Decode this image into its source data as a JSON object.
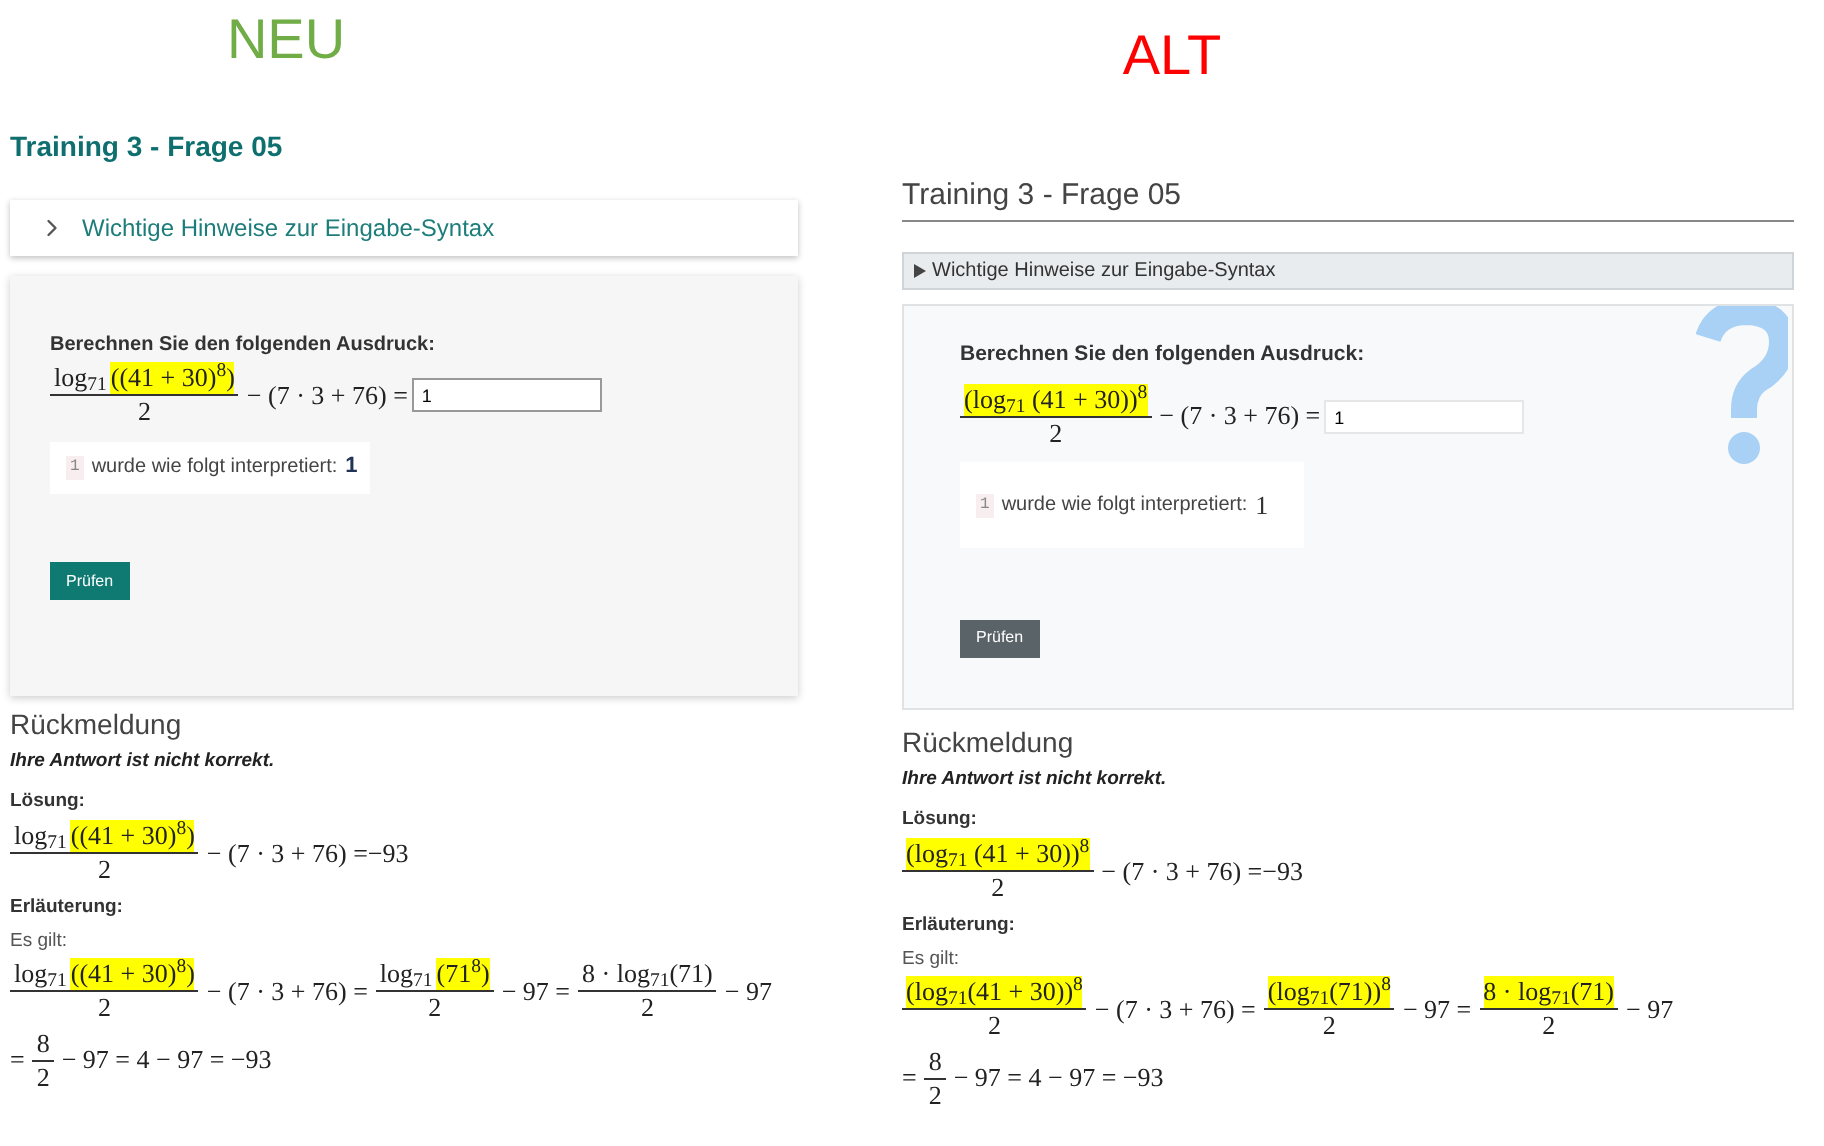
{
  "panels": [
    {
      "kind": "new",
      "label": "NEU",
      "color": "#70ad47",
      "title": "Training 3 - Frage 05",
      "hint": "Wichtige Hinweise zur Eingabe-Syntax",
      "prompt": "Berechnen Sie den folgenden Ausdruck:",
      "equation": [
        {
          "kind": "frac",
          "num": [
            {
              "text": "log$_{71}$",
              "highlighted": false
            },
            {
              "text": "((41 + 30)$^{8}$)",
              "highlighted": true
            }
          ],
          "den": [
            {
              "text": "2",
              "highlighted": false
            }
          ]
        },
        {
          "kind": "text",
          "parts": [
            {
              "text": "− (7 · 3 + 76) =",
              "highlighted": false
            }
          ]
        }
      ],
      "answer": {
        "value": "1"
      },
      "interpretation": {
        "code": "1",
        "text": "wurde wie folgt interpretiert:",
        "value": "1"
      },
      "check_button": "Prüfen",
      "feedback": {
        "heading": "Rückmeldung",
        "verdict": "Ihre Antwort ist nicht korrekt.",
        "solution_label": "Lösung:",
        "solution": [
          {
            "kind": "frac",
            "num": [
              {
                "text": "log$_{71}$",
                "highlighted": false
              },
              {
                "text": "((41 + 30)$^{8}$)",
                "highlighted": true
              }
            ],
            "den": [
              {
                "text": "2",
                "highlighted": false
              }
            ]
          },
          {
            "kind": "text",
            "parts": [
              {
                "text": "− (7 · 3 + 76) =−93",
                "highlighted": false
              }
            ]
          }
        ],
        "explanation_label": "Erläuterung:",
        "explanation_intro": "Es gilt:",
        "explanation_lines": [
          [
            {
              "kind": "frac",
              "num": [
                {
                  "text": "log$_{71}$",
                  "highlighted": false
                },
                {
                  "text": "((41 + 30)$^{8}$)",
                  "highlighted": true
                }
              ],
              "den": [
                {
                  "text": "2",
                  "highlighted": false
                }
              ]
            },
            {
              "kind": "text",
              "parts": [
                {
                  "text": "− (7 · 3 + 76) =",
                  "highlighted": false
                }
              ]
            },
            {
              "kind": "frac",
              "num": [
                {
                  "text": "log$_{71}$",
                  "highlighted": false
                },
                {
                  "text": "(71$^{8}$)",
                  "highlighted": true
                }
              ],
              "den": [
                {
                  "text": "2",
                  "highlighted": false
                }
              ]
            },
            {
              "kind": "text",
              "parts": [
                {
                  "text": "− 97 =",
                  "highlighted": false
                }
              ]
            },
            {
              "kind": "frac",
              "num": [
                {
                  "text": "8 · log$_{71}$(71)",
                  "highlighted": false
                }
              ],
              "den": [
                {
                  "text": "2",
                  "highlighted": false
                }
              ]
            },
            {
              "kind": "text",
              "parts": [
                {
                  "text": "− 97",
                  "highlighted": false
                }
              ]
            }
          ],
          [
            {
              "kind": "text",
              "parts": [
                {
                  "text": "=",
                  "highlighted": false
                }
              ]
            },
            {
              "kind": "frac",
              "num": [
                {
                  "text": "8",
                  "highlighted": false
                }
              ],
              "den": [
                {
                  "text": "2",
                  "highlighted": false
                }
              ]
            },
            {
              "kind": "text",
              "parts": [
                {
                  "text": "− 97 = 4 − 97 = −93",
                  "highlighted": false
                }
              ]
            }
          ]
        ]
      }
    },
    {
      "kind": "old",
      "label": "ALT",
      "color": "#ff0000",
      "title": "Training 3 - Frage 05",
      "hint": "Wichtige Hinweise zur Eingabe-Syntax",
      "prompt": "Berechnen Sie den folgenden Ausdruck:",
      "equation": [
        {
          "kind": "frac",
          "num": [
            {
              "text": "(log$_{71}$ (41 + 30))$^{8}$",
              "highlighted": true
            }
          ],
          "den": [
            {
              "text": "2",
              "highlighted": false
            }
          ]
        },
        {
          "kind": "text",
          "parts": [
            {
              "text": "− (7 · 3 + 76) =",
              "highlighted": false
            }
          ]
        }
      ],
      "answer": {
        "value": "1"
      },
      "interpretation": {
        "code": "1",
        "text": "wurde wie folgt interpretiert:",
        "value": "1"
      },
      "check_button": "Prüfen",
      "feedback": {
        "heading": "Rückmeldung",
        "verdict": "Ihre Antwort ist nicht korrekt.",
        "solution_label": "Lösung:",
        "solution": [
          {
            "kind": "frac",
            "num": [
              {
                "text": "(log$_{71}$ (41 + 30))$^{8}$",
                "highlighted": true
              }
            ],
            "den": [
              {
                "text": "2",
                "highlighted": false
              }
            ]
          },
          {
            "kind": "text",
            "parts": [
              {
                "text": "− (7 · 3 + 76) =−93",
                "highlighted": false
              }
            ]
          }
        ],
        "explanation_label": "Erläuterung:",
        "explanation_intro": "Es gilt:",
        "explanation_lines": [
          [
            {
              "kind": "frac",
              "num": [
                {
                  "text": "(log$_{71}$(41 + 30))$^{8}$",
                  "highlighted": true
                }
              ],
              "den": [
                {
                  "text": "2",
                  "highlighted": false
                }
              ]
            },
            {
              "kind": "text",
              "parts": [
                {
                  "text": "− (7 · 3 + 76) =",
                  "highlighted": false
                }
              ]
            },
            {
              "kind": "frac",
              "num": [
                {
                  "text": "(log$_{71}$(71))$^{8}$",
                  "highlighted": true
                }
              ],
              "den": [
                {
                  "text": "2",
                  "highlighted": false
                }
              ]
            },
            {
              "kind": "text",
              "parts": [
                {
                  "text": "− 97 =",
                  "highlighted": false
                }
              ]
            },
            {
              "kind": "frac",
              "num": [
                {
                  "text": "8 · log$_{71}$(71)",
                  "highlighted": true
                }
              ],
              "den": [
                {
                  "text": "2",
                  "highlighted": false
                }
              ]
            },
            {
              "kind": "text",
              "parts": [
                {
                  "text": "− 97",
                  "highlighted": false
                }
              ]
            }
          ],
          [
            {
              "kind": "text",
              "parts": [
                {
                  "text": "=",
                  "highlighted": false
                }
              ]
            },
            {
              "kind": "frac",
              "num": [
                {
                  "text": "8",
                  "highlighted": false
                }
              ],
              "den": [
                {
                  "text": "2",
                  "highlighted": false
                }
              ]
            },
            {
              "kind": "text",
              "parts": [
                {
                  "text": "− 97 = 4 − 97 = −93",
                  "highlighted": false
                }
              ]
            }
          ]
        ]
      }
    }
  ]
}
